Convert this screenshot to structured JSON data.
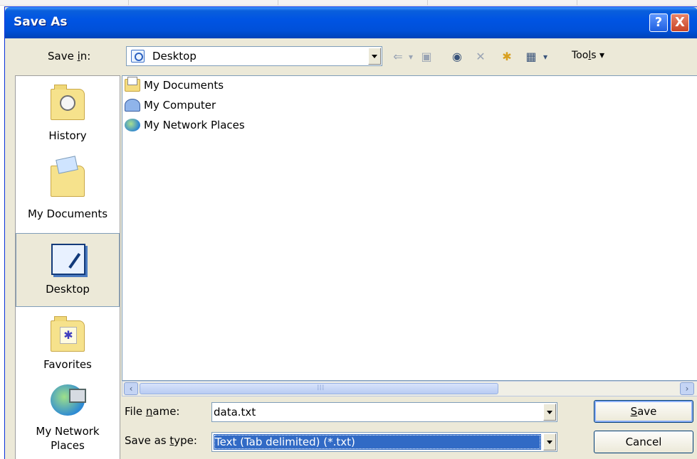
{
  "dialog": {
    "title": "Save As"
  },
  "title_buttons": {
    "help": "?",
    "close": "X"
  },
  "save_in": {
    "label_pre": "Save ",
    "label_u": "i",
    "label_post": "n:",
    "value": "Desktop"
  },
  "toolbar": {
    "back": "⇐",
    "back_drop": "▾",
    "up_folder": "▣",
    "search_web": "◉",
    "delete": "✕",
    "new_folder": "✱",
    "views": "▦",
    "views_drop": "▾",
    "tools_pre": "Too",
    "tools_u": "l",
    "tools_post": "s ▾"
  },
  "places": [
    {
      "label": "History"
    },
    {
      "label": "My Documents"
    },
    {
      "label": "Desktop"
    },
    {
      "label": "Favorites"
    },
    {
      "label_line1": "My Network",
      "label_line2": "Places"
    }
  ],
  "files": [
    {
      "name": "My Documents"
    },
    {
      "name": "My Computer"
    },
    {
      "name": "My Network Places"
    }
  ],
  "scrollbar": {
    "left": "‹",
    "right": "›"
  },
  "file_name": {
    "label_pre": "File ",
    "label_u": "n",
    "label_post": "ame:",
    "value": "data.txt"
  },
  "save_as_type": {
    "label_pre": "Save as ",
    "label_u": "t",
    "label_post": "ype:",
    "value": "Text (Tab delimited) (*.txt)"
  },
  "buttons": {
    "save_u": "S",
    "save_rest": "ave",
    "cancel": "Cancel"
  }
}
